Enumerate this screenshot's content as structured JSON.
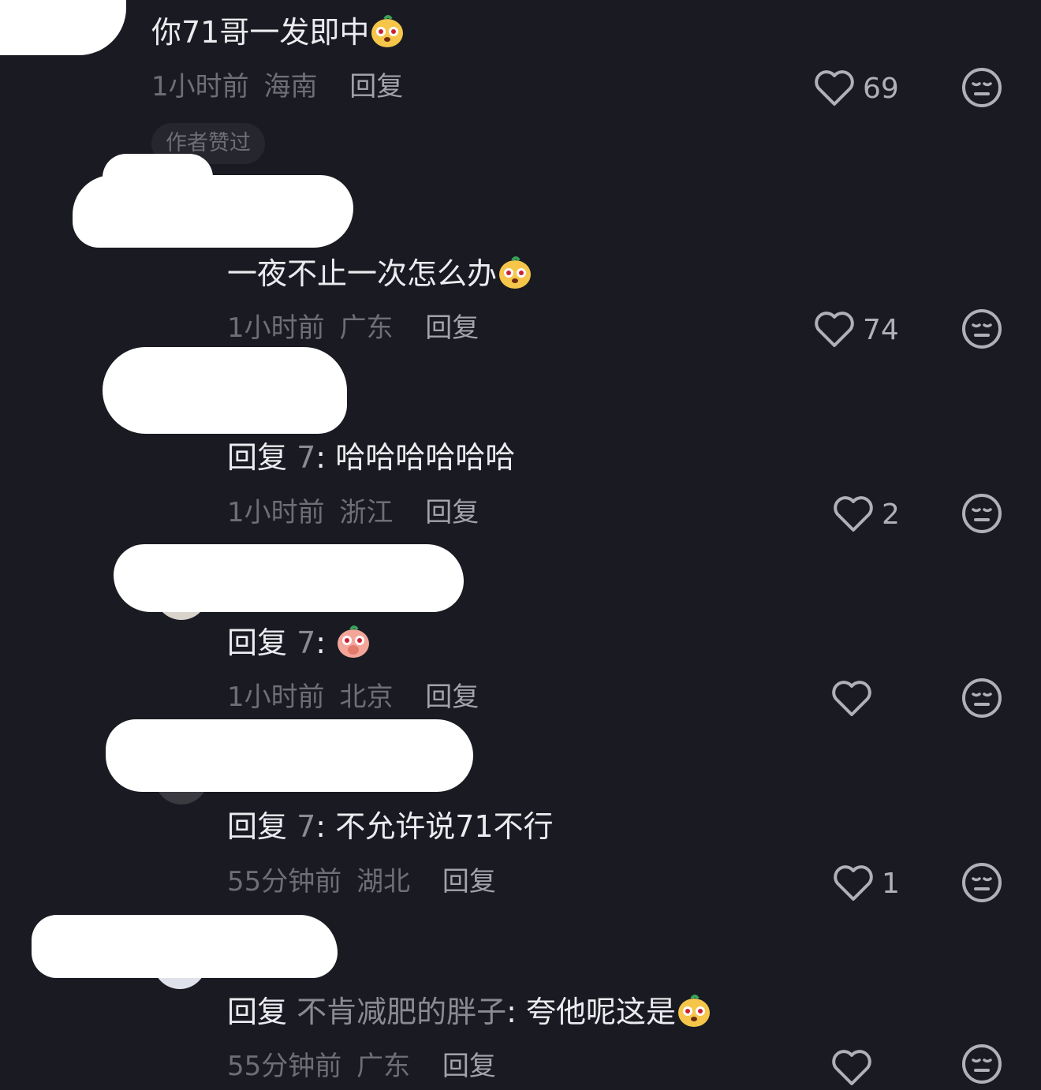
{
  "comments": [
    {
      "text": "你71哥一发即中",
      "time": "1小时前",
      "region": "海南",
      "reply_label": "回复",
      "likes": "69",
      "author_liked_badge": "作者赞过"
    },
    {
      "text": "一夜不止一次怎么办",
      "time": "1小时前",
      "region": "广东",
      "reply_label": "回复",
      "likes": "74"
    },
    {
      "reply_prefix": "回复",
      "reply_target": "7",
      "text": "哈哈哈哈哈哈",
      "time": "1小时前",
      "region": "浙江",
      "reply_label": "回复",
      "likes": "2"
    },
    {
      "reply_prefix": "回复",
      "reply_target": "7",
      "text": "",
      "time": "1小时前",
      "region": "北京",
      "reply_label": "回复",
      "likes": ""
    },
    {
      "reply_prefix": "回复",
      "reply_target": "7",
      "text": "不允许说71不行",
      "time": "55分钟前",
      "region": "湖北",
      "reply_label": "回复",
      "likes": "1"
    },
    {
      "reply_prefix": "回复",
      "reply_target": "不肯减肥的胖子",
      "text": "夸他呢这是",
      "time": "55分钟前",
      "region": "广东",
      "reply_label": "回复",
      "likes": ""
    }
  ],
  "icons": {
    "like": "heart-outline-icon",
    "dislike": "meh-face-icon",
    "emoji": "mango-emoji"
  },
  "colors": {
    "background": "#1a1a22",
    "primary_text": "#ececf0",
    "secondary_text": "#6e6e76",
    "icon": "#b0b0b8"
  }
}
